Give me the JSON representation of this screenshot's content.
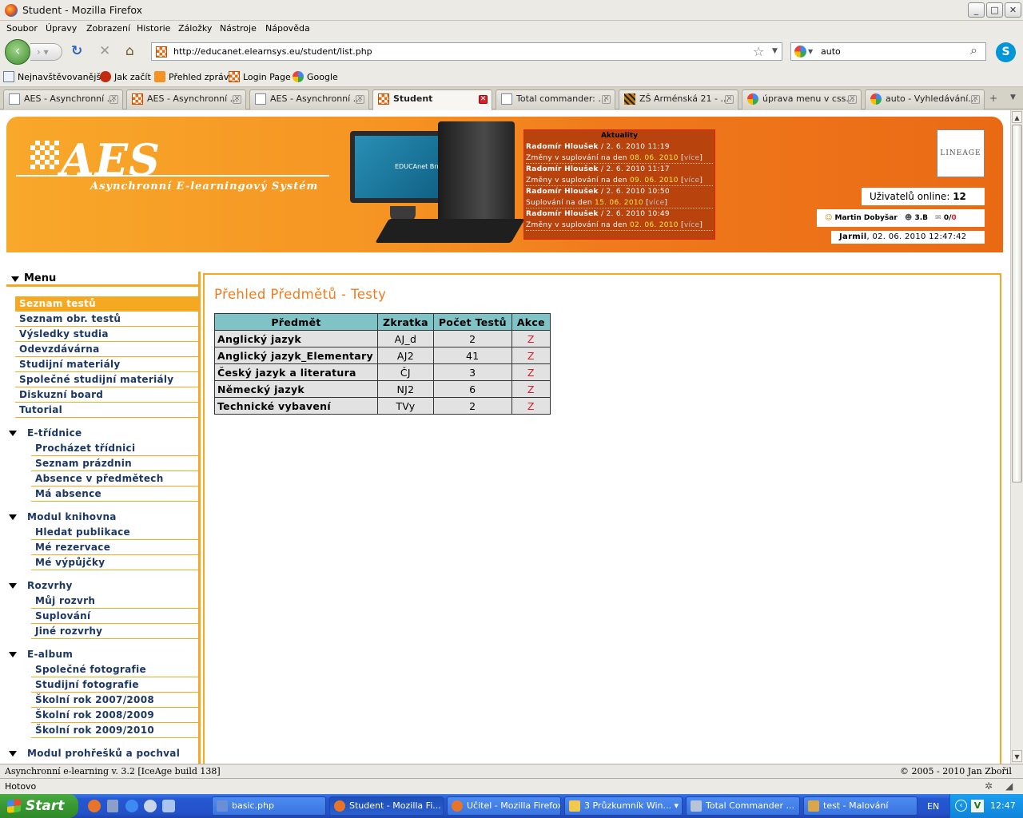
{
  "window": {
    "title": "Student - Mozilla Firefox",
    "buttons": {
      "minimize": "_",
      "maximize": "□",
      "close": "✕"
    }
  },
  "menubar": [
    "Soubor",
    "Úpravy",
    "Zobrazení",
    "Historie",
    "Záložky",
    "Nástroje",
    "Nápověda"
  ],
  "navbar": {
    "back": "‹",
    "forward": "›",
    "reload": "↻",
    "stop": "✕",
    "home": "⌂",
    "url": "http://educanet.elearnsys.eu/student/list.php",
    "bookmark_star": "☆",
    "search_value": "auto",
    "search_icon": "⌕",
    "skype": "S"
  },
  "bookmarks": [
    "Nejnavštěvovanější",
    "Jak začít",
    "Přehled zpráv",
    "Login Page",
    "Google"
  ],
  "tabs": [
    {
      "label": "AES - Asynchronní ...",
      "icon": "doc"
    },
    {
      "label": "AES - Asynchronní ...",
      "icon": "aes"
    },
    {
      "label": "AES - Asynchronní ...",
      "icon": "doc"
    },
    {
      "label": "Student",
      "icon": "aes",
      "active": true
    },
    {
      "label": "Total commander: ...",
      "icon": "doc"
    },
    {
      "label": "ZŠ Arménská 21 - ...",
      "icon": "zs"
    },
    {
      "label": "úprava menu v css...",
      "icon": "goo"
    },
    {
      "label": "auto - Vyhledávání...",
      "icon": "goo"
    }
  ],
  "tab_close": "✕",
  "banner": {
    "logo": "AES",
    "subtitle": "Asynchronní E-learningový Systém",
    "monitor_text": "EDUCAnet Brno",
    "partner_logo": "LINEAGE",
    "users_online_label": "Uživatelů online:",
    "users_online_count": "12",
    "user_name": "Martin Dobyšar",
    "user_class": "3.B",
    "messages_read": "0",
    "messages_sep": "/",
    "messages_unread": "0",
    "greeting_name": "Jarmil",
    "datetime": ", 02. 06. 2010 12:47:42"
  },
  "news": {
    "title": "Aktuality",
    "items": [
      {
        "author": "Radomír Hloušek",
        "date": " / 2. 6. 2010 11:19",
        "text": "Změny v suplování na den ",
        "day": "08. 06. 2010",
        "more": "více"
      },
      {
        "author": "Radomír Hloušek",
        "date": " / 2. 6. 2010 11:17",
        "text": "Změny v suplování na den ",
        "day": "09. 06. 2010",
        "more": "více"
      },
      {
        "author": "Radomír Hloušek",
        "date": " / 2. 6. 2010 10:50",
        "text": "Suplování na den ",
        "day": "15. 06. 2010",
        "more": "více"
      },
      {
        "author": "Radomír Hloušek",
        "date": " / 2. 6. 2010 10:49",
        "text": "Změny v suplování na den ",
        "day": "02. 06. 2010",
        "more": "více"
      }
    ]
  },
  "menu": {
    "title": "Menu",
    "top": [
      "Seznam testů",
      "Seznam obr. testů",
      "Výsledky studia",
      "Odevzdávárna",
      "Studijní materiály",
      "Společné studijní materiály",
      "Diskuzní board",
      "Tutorial"
    ],
    "sections": [
      {
        "title": "E-třídnice",
        "items": [
          "Procházet třídnici",
          "Seznam prázdnin",
          "Absence v předmětech",
          "Má absence"
        ]
      },
      {
        "title": "Modul knihovna",
        "items": [
          "Hledat publikace",
          "Mé rezervace",
          "Mé výpůjčky"
        ]
      },
      {
        "title": "Rozvrhy",
        "items": [
          "Můj rozvrh",
          "Suplování",
          "Jiné rozvrhy"
        ]
      },
      {
        "title": "E-album",
        "items": [
          "Společné fotografie",
          "Studijní fotografie",
          "Školní rok 2007/2008",
          "Školní rok 2008/2009",
          "Školní rok 2009/2010"
        ]
      },
      {
        "title": "Modul prohřešků a pochval",
        "items": []
      }
    ]
  },
  "main": {
    "title": "Přehled Předmětů - Testy",
    "table": {
      "headers": [
        "Předmět",
        "Zkratka",
        "Počet Testů",
        "Akce"
      ],
      "rows": [
        [
          "Anglický jazyk",
          "AJ_d",
          "2",
          "Z"
        ],
        [
          "Anglický jazyk_Elementary",
          "AJ2",
          "41",
          "Z"
        ],
        [
          "Český jazyk a literatura",
          "ČJ",
          "3",
          "Z"
        ],
        [
          "Německý jazyk",
          "NJ2",
          "6",
          "Z"
        ],
        [
          "Technické vybavení",
          "TVy",
          "2",
          "Z"
        ]
      ]
    }
  },
  "footer": {
    "left": "Asynchronní e-learning  v. 3.2 [IceAge build 138]",
    "right": "© 2005 - 2010  Jan Zbořil"
  },
  "status": "Hotovo",
  "taskbar": {
    "start": "Start",
    "buttons": [
      {
        "label": "basic.php",
        "color": "#6a8fd6"
      },
      {
        "label": "Student - Mozilla Fi...",
        "color": "#e8742a",
        "active": true
      },
      {
        "label": "Učitel - Mozilla Firefox",
        "color": "#e8742a"
      },
      {
        "label": "3 Průzkumník Win...",
        "color": "#f2c94c"
      },
      {
        "label": "Total Commander ...",
        "color": "#b8c4d8"
      },
      {
        "label": "test - Malování",
        "color": "#d9a74a"
      }
    ],
    "language": "EN",
    "clock": "12:47"
  }
}
